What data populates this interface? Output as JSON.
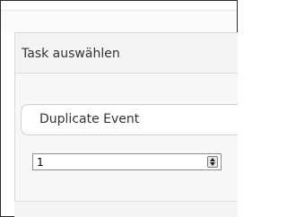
{
  "panel": {
    "title": "Task auswählen"
  },
  "task_select": {
    "selected": "Duplicate Event"
  },
  "count_spinner": {
    "value": "1"
  },
  "icons": {
    "spinner_up": "chevron-up-icon",
    "spinner_down": "chevron-down-icon"
  },
  "colors": {
    "frame_border": "#2b2b2b",
    "panel_background": "#f7f7f7",
    "text": "#333333"
  }
}
